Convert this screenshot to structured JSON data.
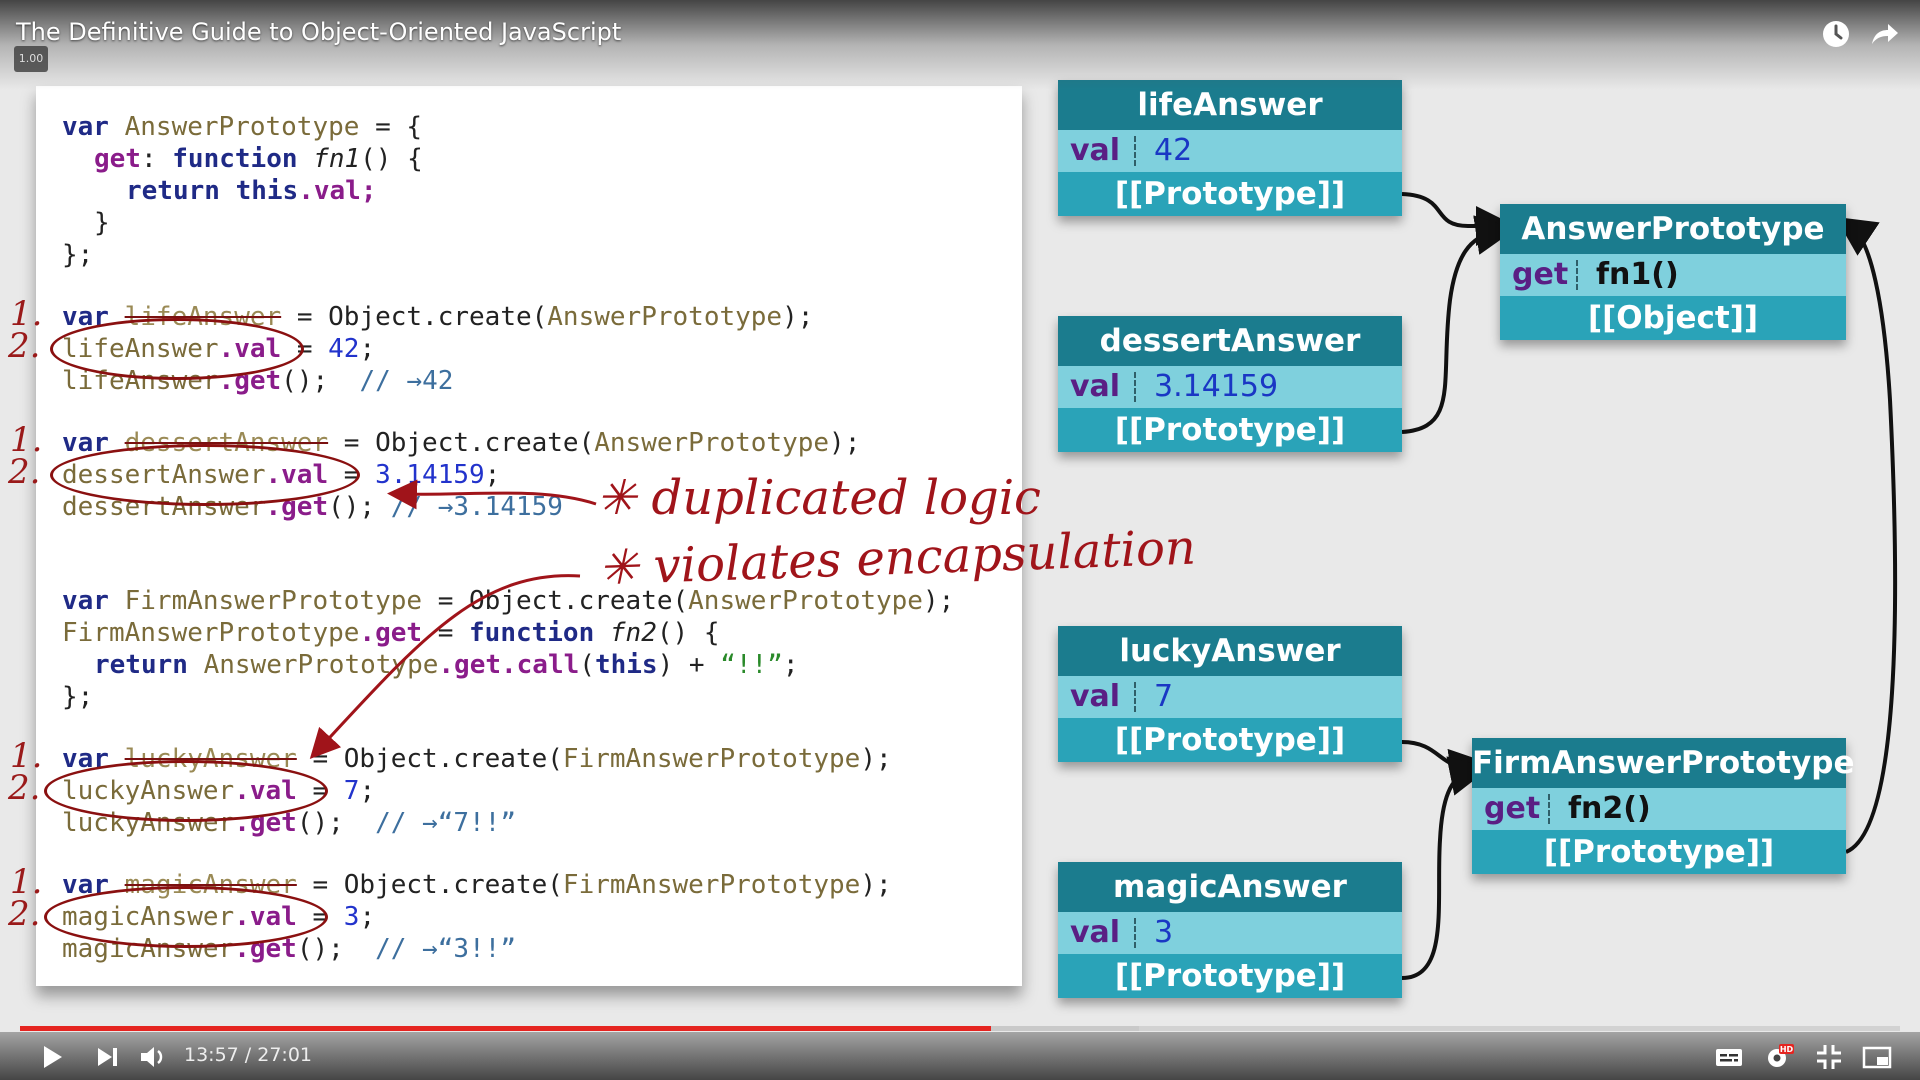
{
  "player": {
    "title": "The Definitive Guide to Object-Oriented JavaScript",
    "speed_badge": "1.00",
    "time_current": "13:57",
    "time_total": "27:01",
    "time_text": "13:57 / 27:01",
    "progress_fraction": 0.5165,
    "buffered_fraction": 0.595,
    "accent_color": "#e52420",
    "icons": [
      "clock-icon",
      "share-icon",
      "play-icon",
      "next-icon",
      "volume-icon",
      "captions-icon",
      "settings-hd-icon",
      "exit-fullscreen-icon",
      "miniplayer-icon"
    ]
  },
  "code": {
    "block1": {
      "l1": {
        "kw": "var",
        "id": "AnswerPrototype",
        "rest": " = {"
      },
      "l2": {
        "prop": "get",
        "colon": ": ",
        "kw": "function",
        "fn": "fn1",
        "rest": "() {"
      },
      "l3": {
        "kw": "return",
        "this": "this",
        "prop": ".val;"
      },
      "l4": "}",
      "l5": "};"
    },
    "life": {
      "l1": {
        "kw": "var",
        "strike": "lifeAnswer",
        "mid": " = Object.create(",
        "id": "AnswerPrototype",
        "end": ");"
      },
      "l2": {
        "id": "lifeAnswer",
        "prop": ".val",
        "mid": " = ",
        "num": "42",
        "end": ";"
      },
      "l3": {
        "id": "lifeAnswer",
        "prop": ".get",
        "mid": "();  ",
        "cmt": "// →42"
      }
    },
    "dessert": {
      "l1": {
        "kw": "var",
        "strike": "dessertAnswer",
        "mid": " = Object.create(",
        "id": "AnswerPrototype",
        "end": ");"
      },
      "l2": {
        "id": "dessertAnswer",
        "prop": ".val",
        "mid": " = ",
        "num": "3.14159",
        "end": ";"
      },
      "l3": {
        "id": "dessertAnswer",
        "prop": ".get",
        "mid": "(); ",
        "cmt": "// →3.14159"
      }
    },
    "firm": {
      "l1": {
        "kw": "var",
        "id": "FirmAnswerPrototype",
        "mid": " = Object.create(",
        "id2": "AnswerPrototype",
        "end": ");"
      },
      "l2": {
        "id": "FirmAnswerPrototype",
        "prop": ".get",
        "mid": " = ",
        "kw": "function",
        "fn": "fn2",
        "end": "() {"
      },
      "l3": {
        "kw": "return",
        "id": "AnswerPrototype",
        "prop": ".get.call",
        "mid": "(",
        "this": "this",
        "mid2": ") + ",
        "str": "“!!”",
        "end": ";"
      },
      "l4": "};"
    },
    "lucky": {
      "l1": {
        "kw": "var",
        "strike": "luckyAnswer",
        "mid": " = Object.create(",
        "id": "FirmAnswerPrototype",
        "end": ");"
      },
      "l2": {
        "id": "luckyAnswer",
        "prop": ".val",
        "mid": " = ",
        "num": "7",
        "end": ";"
      },
      "l3": {
        "id": "luckyAnswer",
        "prop": ".get",
        "mid": "();  ",
        "cmt": "// →“7!!”"
      }
    },
    "magic": {
      "l1": {
        "kw": "var",
        "strike": "magicAnswer",
        "mid": " = Object.create(",
        "id": "FirmAnswerPrototype",
        "end": ");"
      },
      "l2": {
        "id": "magicAnswer",
        "prop": ".val",
        "mid": " = ",
        "num": "3",
        "end": ";"
      },
      "l3": {
        "id": "magicAnswer",
        "prop": ".get",
        "mid": "();  ",
        "cmt": "// →“3!!”"
      }
    }
  },
  "annotations": {
    "step1": "1.",
    "step2": "2.",
    "dup": "✳ duplicated logic",
    "enc": "✳ violates encapsulation"
  },
  "diagram": {
    "lifeAnswer": {
      "title": "lifeAnswer",
      "key": "val",
      "value": "42",
      "proto": "[[Prototype]]"
    },
    "dessertAnswer": {
      "title": "dessertAnswer",
      "key": "val",
      "value": "3.14159",
      "proto": "[[Prototype]]"
    },
    "luckyAnswer": {
      "title": "luckyAnswer",
      "key": "val",
      "value": "7",
      "proto": "[[Prototype]]"
    },
    "magicAnswer": {
      "title": "magicAnswer",
      "key": "val",
      "value": "3",
      "proto": "[[Prototype]]"
    },
    "AnswerPrototype": {
      "title": "AnswerPrototype",
      "key": "get",
      "value": "fn1()",
      "proto": "[[Object]]"
    },
    "FirmAnswerPrototype": {
      "title": "FirmAnswerPrototype",
      "key": "get",
      "value": "fn2()",
      "proto": "[[Prototype]]"
    }
  }
}
